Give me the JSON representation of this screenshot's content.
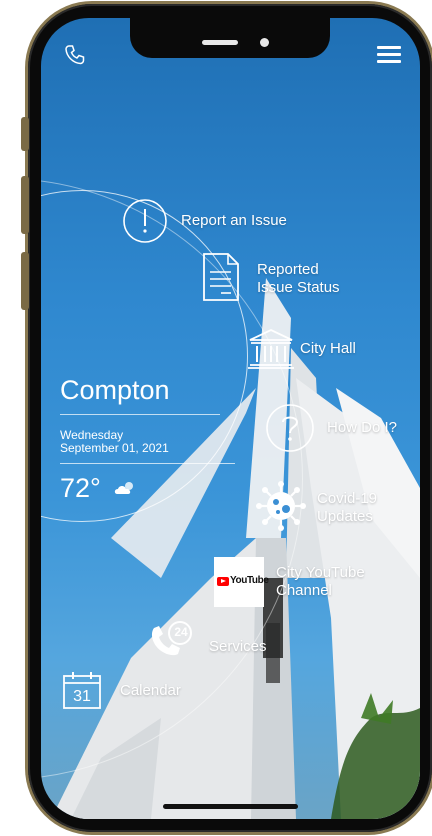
{
  "header": {
    "phone_icon": "phone-icon",
    "menu_icon": "hamburger-menu-icon"
  },
  "weather": {
    "city": "Compton",
    "day": "Wednesday",
    "date": "September 01, 2021",
    "temperature": "72°",
    "condition_icon": "partly-cloudy-icon"
  },
  "menu": {
    "items": [
      {
        "label": "Report an Issue",
        "icon": "exclamation-circle-icon"
      },
      {
        "label": "Reported Issue Status",
        "line1": "Reported",
        "line2": "Issue Status",
        "icon": "document-icon"
      },
      {
        "label": "City Hall",
        "icon": "city-hall-icon"
      },
      {
        "label": "How Do I?",
        "icon": "question-circle-icon"
      },
      {
        "label": "Covid-19 Updates",
        "line1": "Covid-19",
        "line2": "Updates",
        "icon": "virus-icon"
      },
      {
        "label": "City YouTube Channel",
        "line1": "City YouTube",
        "line2": "Channel",
        "icon": "youtube-icon",
        "icon_text": "YouTube"
      },
      {
        "label": "Services",
        "icon": "phone-24-icon",
        "icon_text": "24"
      },
      {
        "label": "Calendar",
        "icon": "calendar-icon",
        "icon_text": "31"
      }
    ]
  },
  "colors": {
    "sky_top": "#1f6fb4",
    "sky_bottom": "#55a6de",
    "frame": "#8a7a52",
    "youtube_red": "#ff0000"
  }
}
